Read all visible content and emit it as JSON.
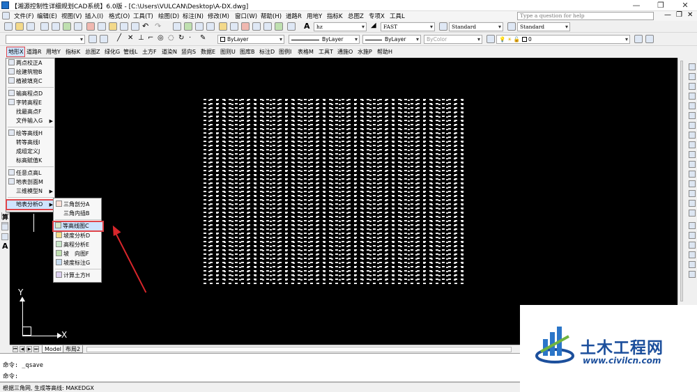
{
  "window": {
    "title": "【湘源控制性详细规划CAD系统】6.0版 - [C:\\Users\\VULCAN\\Desktop\\A-DX.dwg]"
  },
  "menubar": {
    "items": [
      "文件(F)",
      "编辑(E)",
      "视图(V)",
      "插入(I)",
      "格式(O)",
      "工具(T)",
      "绘图(D)",
      "标注(N)",
      "修改(M)",
      "窗口(W)",
      "帮助(H)",
      "道路R",
      "用地Y",
      "指标K",
      "总图Z",
      "专项X",
      "工具L"
    ],
    "help_placeholder": "Type a question for help"
  },
  "toolbar": {
    "text_style": "hz",
    "text_style_2": "FAST",
    "dim_style": "Standard",
    "table_style": "Standard",
    "color": "ByLayer",
    "linetype": "ByLayer",
    "lineweight": "ByLayer",
    "plotstyle": "ByColor",
    "layer": "0"
  },
  "custom_menu": {
    "items": [
      "地形X",
      "道路R",
      "用地Y",
      "指标K",
      "总图Z",
      "绿化G",
      "管线L",
      "土方F",
      "道染N",
      "竖向S",
      "数据E",
      "图则U",
      "图库B",
      "标注D",
      "图例I",
      "表格M",
      "工具T",
      "通施O",
      "水施P",
      "帮助H"
    ],
    "active_index": 0
  },
  "dropdown": {
    "items": [
      {
        "label": "两点校正A",
        "icon": "calibrate-icon",
        "sub": false
      },
      {
        "label": "绘建筑物B",
        "icon": "building-icon",
        "sub": false
      },
      {
        "label": "植被填充C",
        "icon": "vegetation-icon",
        "sub": false
      },
      {
        "sep": true
      },
      {
        "label": "输高程点D",
        "icon": "elevation-point-icon",
        "sub": false
      },
      {
        "label": "字转高程E",
        "icon": "text-to-elevation-icon",
        "sub": false
      },
      {
        "label": "找最高点F",
        "icon": "",
        "sub": false
      },
      {
        "label": "文件输入G",
        "icon": "",
        "sub": true
      },
      {
        "sep": true
      },
      {
        "label": "绘等高线H",
        "icon": "contour-draw-icon",
        "sub": false
      },
      {
        "label": "转等高线I",
        "icon": "",
        "sub": false
      },
      {
        "label": "成组定义J",
        "icon": "",
        "sub": false
      },
      {
        "label": "标高赋值K",
        "icon": "",
        "sub": false
      },
      {
        "sep": true
      },
      {
        "label": "任意点高L",
        "icon": "point-height-icon",
        "sub": false
      },
      {
        "label": "地表剖面M",
        "icon": "profile-icon",
        "sub": false
      },
      {
        "label": "三维模型N",
        "icon": "",
        "sub": true
      },
      {
        "sep": true
      },
      {
        "label": "地表分析O",
        "icon": "",
        "sub": true,
        "highlight": true
      }
    ]
  },
  "submenu": {
    "items": [
      {
        "label": "三角剖分A",
        "icon": "triangulate-icon"
      },
      {
        "label": "三角内插B",
        "icon": ""
      },
      {
        "sep": true
      },
      {
        "label": "等高线图C",
        "icon": "contour-map-icon",
        "highlight": true
      },
      {
        "label": "坡度分析D",
        "icon": "slope-analysis-icon"
      },
      {
        "label": "高程分析E",
        "icon": "elevation-analysis-icon"
      },
      {
        "label": "坡　向图F",
        "icon": "aspect-map-icon"
      },
      {
        "label": "坡度标注G",
        "icon": "slope-label-icon"
      },
      {
        "sep": true
      },
      {
        "label": "计算土方H",
        "icon": "earthwork-icon"
      }
    ]
  },
  "ucs": {
    "x_label": "X",
    "y_label": "Y"
  },
  "layout_tabs": [
    "Model",
    "布局2"
  ],
  "command": {
    "lines": [
      "命令: _qsave",
      "命令:"
    ]
  },
  "status": {
    "text": "根据三角网, 生成等高线:  MAKEDGX"
  },
  "watermark": {
    "cn": "土木工程网",
    "url": "www.civilcn.com"
  },
  "colors": {
    "highlight_border": "#e0454a",
    "highlight_bg": "#cfe4ff",
    "arrow": "#d8262b",
    "brand": "#1c4f9c"
  }
}
